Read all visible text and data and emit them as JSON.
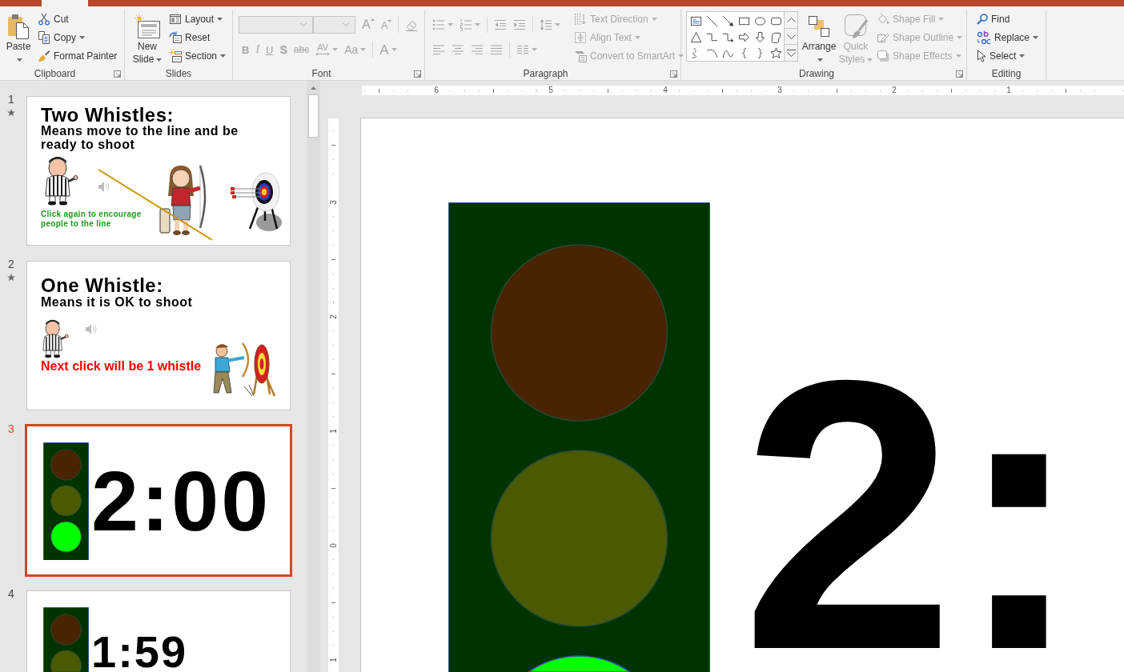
{
  "ribbon": {
    "groups": [
      {
        "label": "Clipboard",
        "launcher": true,
        "items": [
          {
            "kind": "large",
            "label": "Paste",
            "dropdown": true,
            "disabled": false
          },
          {
            "kind": "small",
            "label": "Cut",
            "dropdown": false,
            "disabled": false
          },
          {
            "kind": "small",
            "label": "Copy",
            "dropdown": true,
            "disabled": false
          },
          {
            "kind": "small",
            "label": "Format Painter",
            "dropdown": false,
            "disabled": false
          }
        ]
      },
      {
        "label": "Slides",
        "launcher": false,
        "items": [
          {
            "kind": "large",
            "label": "New Slide",
            "dropdown": true,
            "disabled": false
          },
          {
            "kind": "small",
            "label": "Layout",
            "dropdown": true,
            "disabled": false
          },
          {
            "kind": "small",
            "label": "Reset",
            "dropdown": false,
            "disabled": false
          },
          {
            "kind": "small",
            "label": "Section",
            "dropdown": true,
            "disabled": false
          }
        ]
      },
      {
        "label": "Font",
        "launcher": true,
        "items": [
          {
            "kind": "combo",
            "dropdown": true,
            "disabled": true
          },
          {
            "kind": "combo",
            "dropdown": true,
            "disabled": true
          },
          {
            "kind": "glyph",
            "text": "A",
            "dropdown": false,
            "disabled": true
          },
          {
            "kind": "glyph",
            "text": "A",
            "dropdown": false,
            "disabled": true
          },
          {
            "kind": "icon",
            "dropdown": false,
            "disabled": true
          },
          {
            "kind": "glyph",
            "text": "B",
            "dropdown": false,
            "disabled": true
          },
          {
            "kind": "glyph",
            "text": "I",
            "dropdown": false,
            "disabled": true
          },
          {
            "kind": "glyph",
            "text": "U",
            "dropdown": false,
            "disabled": true
          },
          {
            "kind": "glyph",
            "text": "S",
            "dropdown": false,
            "disabled": true
          },
          {
            "kind": "glyph",
            "text": "abc",
            "dropdown": false,
            "disabled": true
          },
          {
            "kind": "glyph",
            "text": "AV",
            "dropdown": true,
            "disabled": true
          },
          {
            "kind": "glyph",
            "text": "Aa",
            "dropdown": true,
            "disabled": true
          },
          {
            "kind": "glyph",
            "text": "A",
            "dropdown": true,
            "disabled": true
          }
        ]
      },
      {
        "label": "Paragraph",
        "launcher": true,
        "items": [
          {
            "kind": "icon",
            "dropdown": true,
            "disabled": true
          },
          {
            "kind": "icon",
            "dropdown": true,
            "disabled": true
          },
          {
            "kind": "icon",
            "dropdown": false,
            "disabled": true
          },
          {
            "kind": "icon",
            "dropdown": false,
            "disabled": true
          },
          {
            "kind": "icon",
            "dropdown": true,
            "disabled": true
          },
          {
            "kind": "small",
            "label": "Text Direction",
            "dropdown": true,
            "disabled": true
          },
          {
            "kind": "small",
            "label": "Align Text",
            "dropdown": true,
            "disabled": true
          },
          {
            "kind": "icon",
            "dropdown": false,
            "disabled": true
          },
          {
            "kind": "icon",
            "dropdown": false,
            "disabled": true
          },
          {
            "kind": "icon",
            "dropdown": false,
            "disabled": true
          },
          {
            "kind": "icon",
            "dropdown": false,
            "disabled": true
          },
          {
            "kind": "icon",
            "dropdown": true,
            "disabled": true
          },
          {
            "kind": "small",
            "label": "Convert to SmartArt",
            "dropdown": true,
            "disabled": true
          }
        ]
      },
      {
        "label": "Drawing",
        "launcher": true,
        "items": [
          {
            "kind": "gallery",
            "disabled": false
          },
          {
            "kind": "large",
            "label": "Arrange",
            "dropdown": true,
            "disabled": false
          },
          {
            "kind": "large",
            "label": "Quick Styles",
            "dropdown": true,
            "disabled": true
          },
          {
            "kind": "small",
            "label": "Shape Fill",
            "dropdown": true,
            "disabled": true
          },
          {
            "kind": "small",
            "label": "Shape Outline",
            "dropdown": true,
            "disabled": true
          },
          {
            "kind": "small",
            "label": "Shape Effects",
            "dropdown": true,
            "disabled": true
          }
        ]
      },
      {
        "label": "Editing",
        "launcher": false,
        "items": [
          {
            "kind": "small",
            "label": "Find",
            "dropdown": false,
            "disabled": false
          },
          {
            "kind": "small",
            "label": "Replace",
            "dropdown": true,
            "disabled": false
          },
          {
            "kind": "small",
            "label": "Select",
            "dropdown": true,
            "disabled": false
          }
        ]
      }
    ]
  },
  "slides": [
    {
      "number": "1",
      "animated": true,
      "selected": false,
      "kind": "instructions",
      "title": "Two Whistles:",
      "subtitle": "Means move to the line and be ready to shoot",
      "note": {
        "text": "Click again to encourage people to the line",
        "color": "#1a9c1a"
      }
    },
    {
      "number": "2",
      "animated": true,
      "selected": false,
      "kind": "instructions",
      "title": "One Whistle:",
      "subtitle": "Means it is OK to shoot",
      "note": {
        "text": "Next click will be 1 whistle",
        "color": "#ff0000"
      }
    },
    {
      "number": "3",
      "animated": false,
      "selected": true,
      "kind": "timer",
      "time": "2:00",
      "lights": [
        {
          "color": "#4a2300"
        },
        {
          "color": "#4b5a00"
        },
        {
          "color": "#00ff00"
        }
      ]
    },
    {
      "number": "4",
      "animated": false,
      "selected": false,
      "kind": "timer",
      "time": "1:59",
      "lights": [
        {
          "color": "#4a2300"
        },
        {
          "color": "#4b5a00"
        }
      ]
    }
  ],
  "rulers": {
    "horizontal": [
      "6",
      "5",
      "4",
      "3",
      "2",
      "1"
    ],
    "vertical": [
      "3",
      "2",
      "1",
      "0",
      "1"
    ]
  },
  "editor": {
    "time": "2:",
    "lights": [
      {
        "color": "#4a2300"
      },
      {
        "color": "#4b5a00"
      },
      {
        "color": "#00ff00"
      }
    ]
  }
}
